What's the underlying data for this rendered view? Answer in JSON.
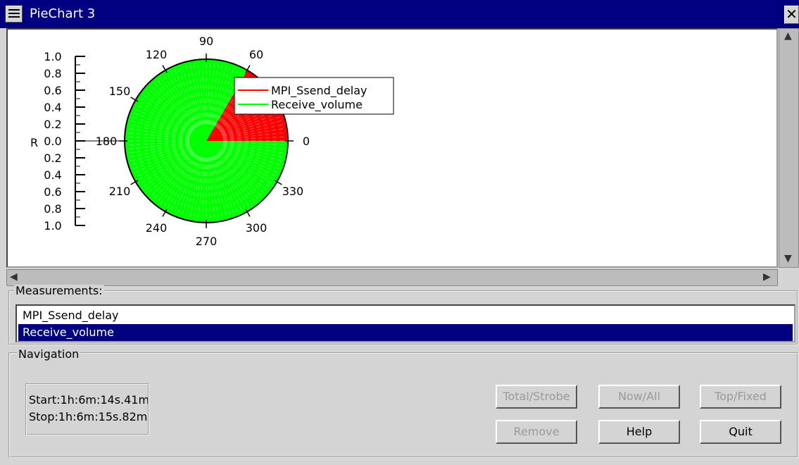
{
  "window": {
    "title": "PieChart 3"
  },
  "chart_data": {
    "type": "pie",
    "slices": [
      {
        "name": "MPI_Ssend_delay",
        "color": "#ff0000",
        "start_angle": 0,
        "end_angle": 60
      },
      {
        "name": "Receive_volume",
        "color": "#00ff00",
        "start_angle": 60,
        "end_angle": 360
      }
    ],
    "angle_labels": [
      "90",
      "60",
      "120",
      "150",
      "180",
      "0",
      "210",
      "330",
      "240",
      "300",
      "270"
    ],
    "r_label": "R",
    "r_ticks": [
      "1.0",
      "0.8",
      "0.6",
      "0.4",
      "0.2",
      "0.0",
      "0.2",
      "0.4",
      "0.6",
      "0.8",
      "1.0"
    ],
    "legend": [
      "MPI_Ssend_delay",
      "Receive_volume"
    ],
    "legend_position": "top-right of pie"
  },
  "measurements": {
    "label": "Measurements:",
    "items": [
      "MPI_Ssend_delay",
      "Receive_volume"
    ],
    "selected": "Receive_volume"
  },
  "navigation": {
    "label": "Navigation",
    "start": "Start:1h:6m:14s.41m",
    "stop": "Stop:1h:6m:15s.82m",
    "buttons": {
      "total_strobe": "Total/Strobe",
      "now_all": "Now/All",
      "top_fixed": "Top/Fixed",
      "remove": "Remove",
      "help": "Help",
      "quit": "Quit"
    }
  }
}
